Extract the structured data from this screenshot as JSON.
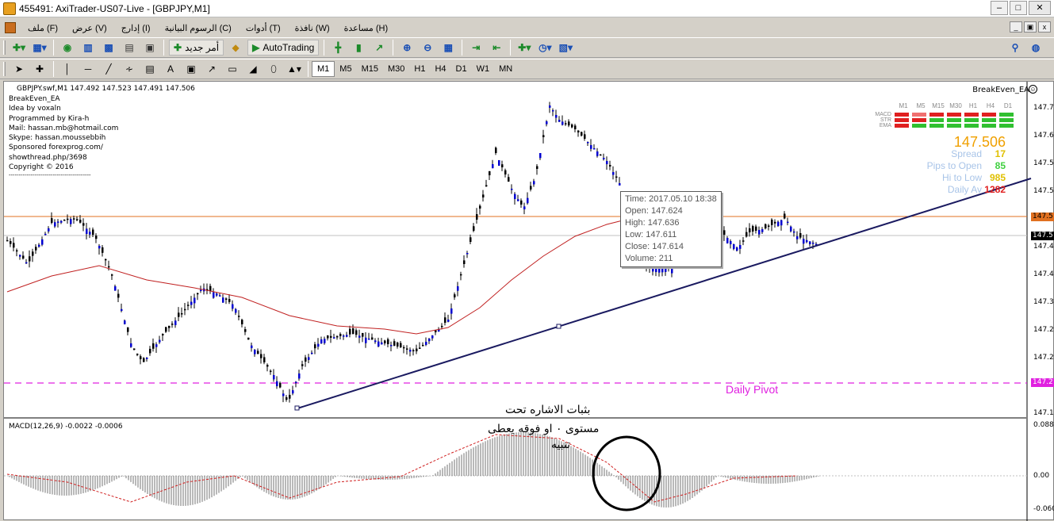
{
  "window": {
    "title": "455491: AxiTrader-US07-Live - [GBPJPY,M1]"
  },
  "menu": {
    "items": [
      "ملف (F)",
      "عرض (V)",
      "إدارج (I)",
      "الرسوم البيانية (C)",
      "أدوات (T)",
      "نافذة (W)",
      "مساعدة (H)"
    ]
  },
  "toolbar": {
    "new_order_label": "أمر جديد",
    "autotrading_label": "AutoTrading",
    "timeframes": [
      "M1",
      "M5",
      "M15",
      "M30",
      "H1",
      "H4",
      "D1",
      "W1",
      "MN"
    ],
    "active_timeframe": "M1"
  },
  "chart": {
    "symbol_line": "GBPJPY.swf,M1  147.492 147.523 147.491 147.506",
    "ea_name": "BreakEven_EA",
    "info_lines": [
      "BreakEven_EA",
      "Idea by voxaln",
      "Programmed by Kira-h",
      "Mail: hassan.mb@hotmail.com",
      "Skype: hassan.moussebbih",
      "Sponsored forexprog.com/",
      "showthread.php/3698",
      "Copyright © 2016",
      "-----------------------------------------"
    ],
    "price_axis": [
      "147.70",
      "147.60",
      "147.50",
      "147.40",
      "147.30",
      "147.20",
      "147.10"
    ],
    "price_tags": [
      "147.5",
      "147.5",
      "147.2"
    ],
    "pivot_label": "Daily Pivot",
    "tooltip": {
      "time": "Time: 2017.05.10 18:38",
      "open": "Open: 147.624",
      "high": "High: 147.636",
      "low": "Low:  147.611",
      "close": "Close: 147.614",
      "volume": "Volume: 211"
    },
    "ea_panel": {
      "tf_headers": [
        "M1",
        "M5",
        "M15",
        "M30",
        "H1",
        "H4",
        "D1"
      ],
      "indicators": [
        "MACD",
        "STR",
        "EMA"
      ],
      "price": "147.506",
      "stats": [
        {
          "label": "Spread",
          "value": "17",
          "color": "#e0c000"
        },
        {
          "label": "Pips to Open",
          "value": "85",
          "color": "#40d040"
        },
        {
          "label": "Hi to Low",
          "value": "985",
          "color": "#e0c000"
        },
        {
          "label": "Daily Av",
          "value": "1282",
          "color": "#e02020"
        }
      ]
    },
    "annotation_lines": [
      "بثبات الاشاره تحت",
      "مستوى ٠ او فوقه يعطى",
      "تنبيه"
    ],
    "macd_label": "MACD(12,26,9) -0.0022 -0.0006",
    "macd_axis": [
      "0.0884",
      "0.00",
      "-0.060"
    ]
  }
}
